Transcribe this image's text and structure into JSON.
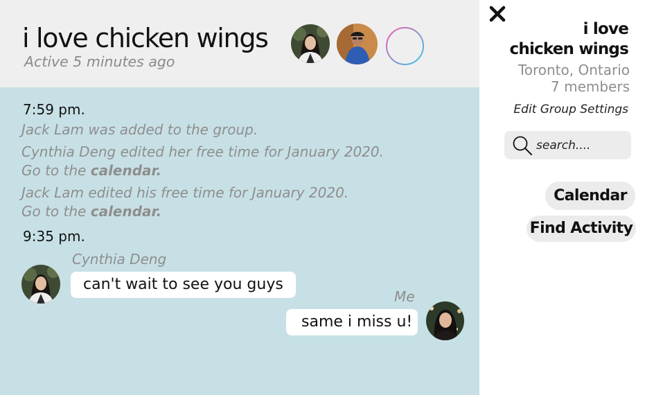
{
  "chat": {
    "header": {
      "title": "i love chicken wings",
      "status": "Active 5 minutes ago"
    },
    "timeline": [
      {
        "time": "7:59 pm."
      },
      {
        "time": "9:35 pm."
      }
    ],
    "system_messages": {
      "added": "Jack Lam was added to the group.",
      "cynthia_edit": "Cynthia Deng edited her free time for January 2020.",
      "jack_edit": "Jack Lam edited his free time for January 2020.",
      "goto_prefix": "Go to the ",
      "goto_link": "calendar."
    },
    "messages": [
      {
        "sender": "Cynthia Deng",
        "text": "can't wait to see you guys"
      },
      {
        "sender": "Me",
        "text": "same i miss u!"
      }
    ]
  },
  "panel": {
    "title_line1": "i love",
    "title_line2": "chicken wings",
    "location": "Toronto, Ontario",
    "members": "7 members",
    "edit_settings": "Edit Group Settings",
    "search_placeholder": "search....",
    "calendar_button": "Calendar",
    "find_activity_button": "Find Activity"
  },
  "icons": {
    "close": "close-icon",
    "search": "search-icon",
    "add": "add-member-icon"
  },
  "colors": {
    "chat_background": "#c7e0e5",
    "header_background": "#efefef",
    "add_gradient_start": "#f25ab4",
    "add_gradient_end": "#34c7e8"
  }
}
